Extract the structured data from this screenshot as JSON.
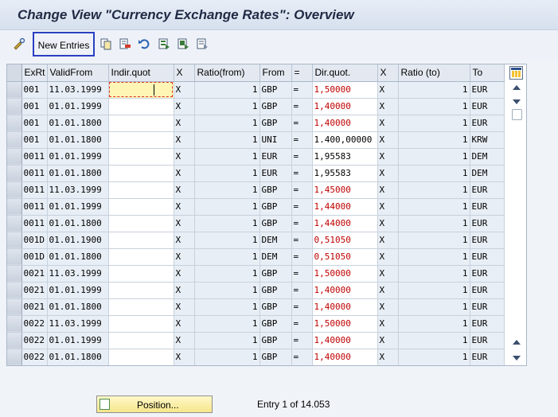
{
  "title": "Change View \"Currency Exchange Rates\": Overview",
  "toolbar": {
    "new_entries_label": "New Entries",
    "icons": [
      "change-display-icon",
      "copy-icon",
      "delete-icon",
      "undo-icon",
      "select-all-icon",
      "select-block-icon",
      "deselect-all-icon"
    ]
  },
  "table": {
    "columns": [
      "ExRt",
      "ValidFrom",
      "Indir.quot",
      "X",
      "Ratio(from)",
      "From",
      "=",
      "Dir.quot.",
      "X",
      "Ratio (to)",
      "To"
    ],
    "rows": [
      [
        "001",
        "11.03.1999",
        "",
        "X",
        "1",
        "GBP",
        "=",
        "1,50000",
        "X",
        "1",
        "EUR"
      ],
      [
        "001",
        "01.01.1999",
        "",
        "X",
        "1",
        "GBP",
        "=",
        "1,40000",
        "X",
        "1",
        "EUR"
      ],
      [
        "001",
        "01.01.1800",
        "",
        "X",
        "1",
        "GBP",
        "=",
        "1,40000",
        "X",
        "1",
        "EUR"
      ],
      [
        "001",
        "01.01.1800",
        "",
        "X",
        "1",
        "UNI",
        "=",
        "1.400,00000",
        "X",
        "1",
        "KRW"
      ],
      [
        "0011",
        "01.01.1999",
        "",
        "X",
        "1",
        "EUR",
        "=",
        "1,95583",
        "X",
        "1",
        "DEM"
      ],
      [
        "0011",
        "01.01.1800",
        "",
        "X",
        "1",
        "EUR",
        "=",
        "1,95583",
        "X",
        "1",
        "DEM"
      ],
      [
        "0011",
        "11.03.1999",
        "",
        "X",
        "1",
        "GBP",
        "=",
        "1,45000",
        "X",
        "1",
        "EUR"
      ],
      [
        "0011",
        "01.01.1999",
        "",
        "X",
        "1",
        "GBP",
        "=",
        "1,44000",
        "X",
        "1",
        "EUR"
      ],
      [
        "0011",
        "01.01.1800",
        "",
        "X",
        "1",
        "GBP",
        "=",
        "1,44000",
        "X",
        "1",
        "EUR"
      ],
      [
        "001D",
        "01.01.1900",
        "",
        "X",
        "1",
        "DEM",
        "=",
        "0,51050",
        "X",
        "1",
        "EUR"
      ],
      [
        "001D",
        "01.01.1800",
        "",
        "X",
        "1",
        "DEM",
        "=",
        "0,51050",
        "X",
        "1",
        "EUR"
      ],
      [
        "0021",
        "11.03.1999",
        "",
        "X",
        "1",
        "GBP",
        "=",
        "1,50000",
        "X",
        "1",
        "EUR"
      ],
      [
        "0021",
        "01.01.1999",
        "",
        "X",
        "1",
        "GBP",
        "=",
        "1,40000",
        "X",
        "1",
        "EUR"
      ],
      [
        "0021",
        "01.01.1800",
        "",
        "X",
        "1",
        "GBP",
        "=",
        "1,40000",
        "X",
        "1",
        "EUR"
      ],
      [
        "0022",
        "11.03.1999",
        "",
        "X",
        "1",
        "GBP",
        "=",
        "1,50000",
        "X",
        "1",
        "EUR"
      ],
      [
        "0022",
        "01.01.1999",
        "",
        "X",
        "1",
        "GBP",
        "=",
        "1,40000",
        "X",
        "1",
        "EUR"
      ],
      [
        "0022",
        "01.01.1800",
        "",
        "X",
        "1",
        "GBP",
        "=",
        "1,40000",
        "X",
        "1",
        "EUR"
      ]
    ],
    "red_rows": [
      0,
      1,
      2,
      6,
      7,
      8,
      9,
      10,
      11,
      12,
      13,
      14,
      15,
      16
    ]
  },
  "footer": {
    "position_label": "Position...",
    "entry_text": "Entry 1 of 14.053"
  },
  "colors": {
    "title": "#1f2a44",
    "highlight_border": "#2a3fc2",
    "dir_quot_red": "#c00000",
    "focus_cell": "#fff6b5"
  }
}
